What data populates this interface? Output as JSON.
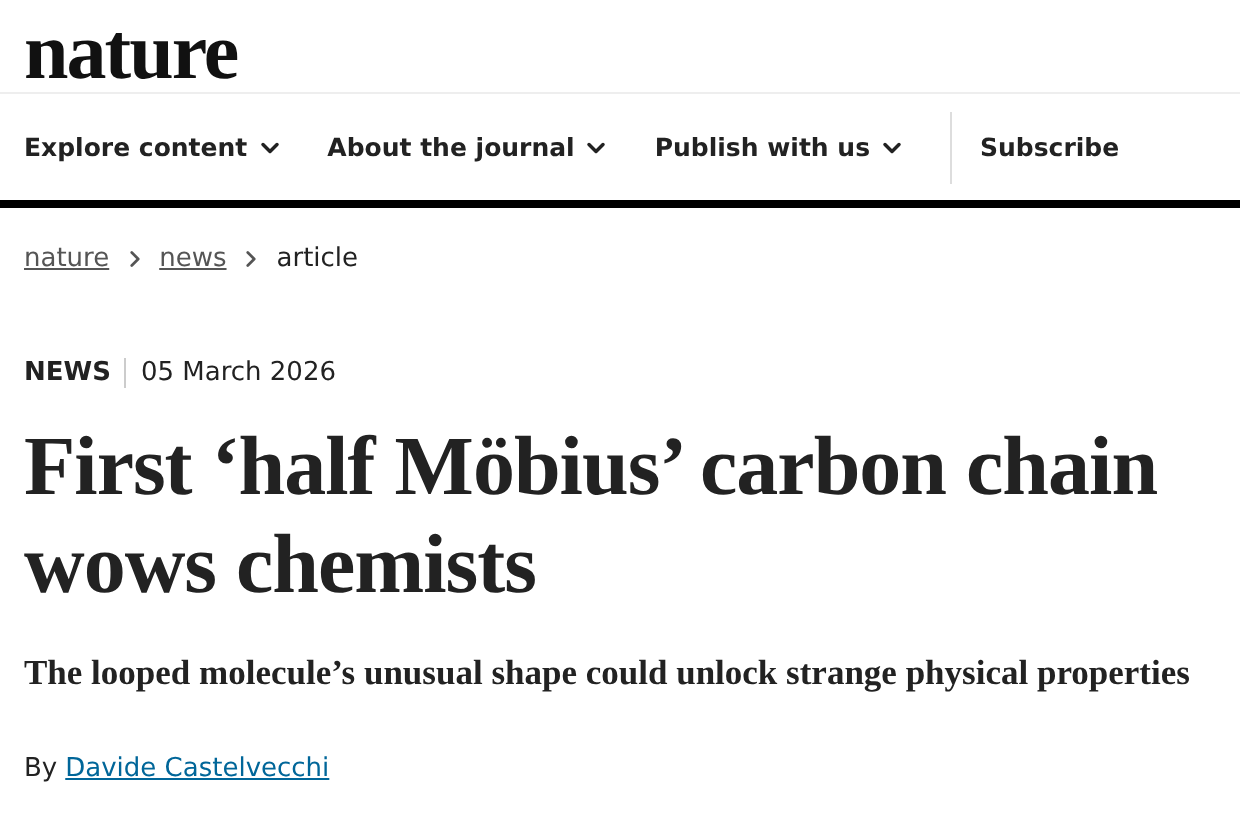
{
  "logo": "nature",
  "nav": [
    {
      "label": "Explore content",
      "dropdown": true
    },
    {
      "label": "About the journal",
      "dropdown": true
    },
    {
      "label": "Publish with us",
      "dropdown": true
    },
    {
      "label": "Subscribe",
      "dropdown": false
    }
  ],
  "breadcrumb": [
    {
      "label": "nature",
      "link": true
    },
    {
      "label": "news",
      "link": true
    },
    {
      "label": "article",
      "link": false
    }
  ],
  "article": {
    "type": "NEWS",
    "date": "05 March 2026",
    "title": "First ‘half Möbius’ carbon chain wows chemists",
    "standfirst": "The looped molecule’s unusual shape could unlock strange physical properties",
    "byline_prefix": "By",
    "author": "Davide Castelvecchi"
  }
}
